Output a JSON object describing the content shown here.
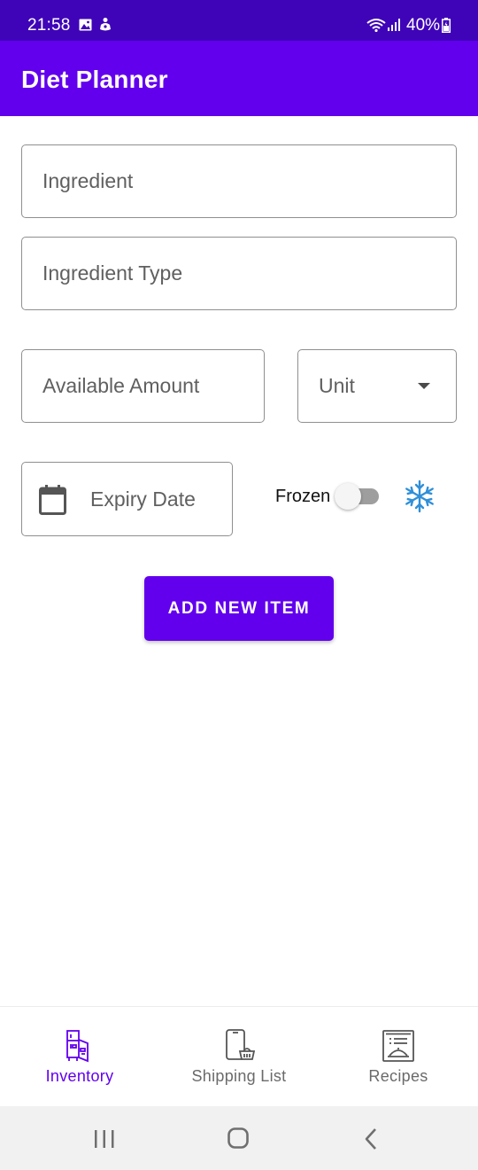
{
  "status_bar": {
    "time": "21:58",
    "battery": "40%",
    "icons": [
      "gallery-icon",
      "notification-icon",
      "wifi-icon",
      "signal-icon",
      "battery-icon"
    ]
  },
  "app_bar": {
    "title": "Diet Planner",
    "color": "#6200ee"
  },
  "form": {
    "ingredient_placeholder": "Ingredient",
    "ingredient_type_placeholder": "Ingredient Type",
    "amount_placeholder": "Available Amount",
    "unit_placeholder": "Unit",
    "expiry_placeholder": "Expiry Date",
    "frozen_label": "Frozen",
    "frozen_on": false,
    "add_button_label": "ADD NEW ITEM"
  },
  "bottom_nav": {
    "items": [
      {
        "label": "Inventory",
        "icon": "fridge-icon",
        "active": true
      },
      {
        "label": "Shipping List",
        "icon": "phone-basket-icon",
        "active": false
      },
      {
        "label": "Recipes",
        "icon": "recipe-card-icon",
        "active": false
      }
    ]
  },
  "colors": {
    "primary": "#6200ee",
    "status_bar": "#3f04b8",
    "snowflake": "#2f8fd8"
  }
}
